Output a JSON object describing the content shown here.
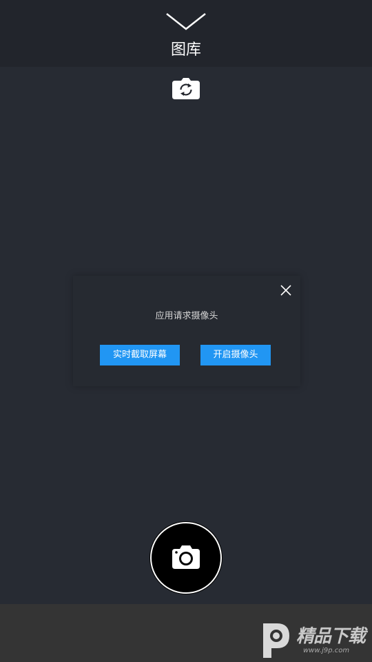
{
  "header": {
    "title": "图库",
    "collapse_icon": "chevron-down-icon"
  },
  "toolbar": {
    "switch_camera_icon": "switch-camera-icon"
  },
  "dialog": {
    "message": "应用请求摄像头",
    "close_icon": "close-icon",
    "capture_screen_label": "实时截取屏幕",
    "open_camera_label": "开启摄像头"
  },
  "shutter": {
    "icon": "camera-icon"
  },
  "watermark": {
    "text": "精品下载",
    "url": "www.j9p.com"
  },
  "colors": {
    "background": "#272b33",
    "header": "#22252c",
    "accent": "#2196f3",
    "bottom_bar": "#343434"
  }
}
